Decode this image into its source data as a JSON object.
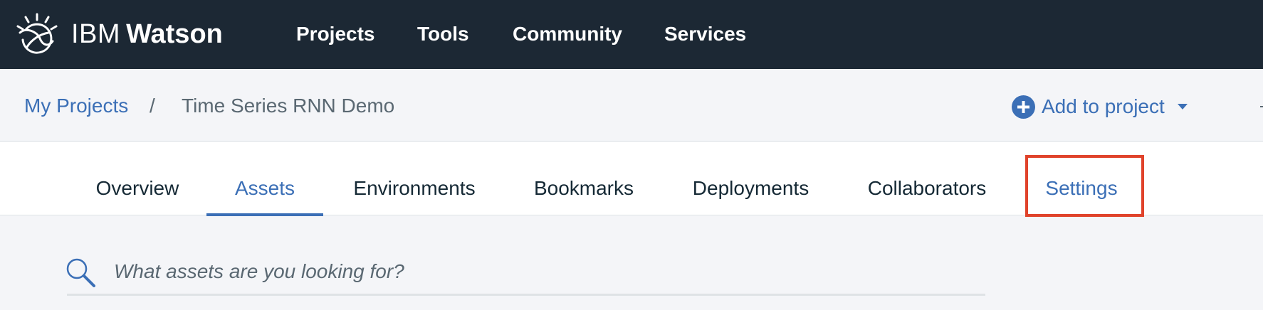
{
  "brand": {
    "prefix": "IBM",
    "name": "Watson"
  },
  "nav": {
    "items": [
      {
        "label": "Projects"
      },
      {
        "label": "Tools"
      },
      {
        "label": "Community"
      },
      {
        "label": "Services"
      }
    ]
  },
  "breadcrumb": {
    "root": "My Projects",
    "separator": "/",
    "current": "Time Series RNN Demo"
  },
  "actions": {
    "add_to_project": "Add to project"
  },
  "tabs": {
    "items": [
      {
        "label": "Overview"
      },
      {
        "label": "Assets",
        "active": true
      },
      {
        "label": "Environments"
      },
      {
        "label": "Bookmarks"
      },
      {
        "label": "Deployments"
      },
      {
        "label": "Collaborators"
      },
      {
        "label": "Settings",
        "highlighted": true
      }
    ]
  },
  "search": {
    "placeholder": "What assets are you looking for?",
    "value": ""
  },
  "colors": {
    "topbar": "#1c2834",
    "accent": "#3b6fb6",
    "highlight": "#e0432b"
  }
}
